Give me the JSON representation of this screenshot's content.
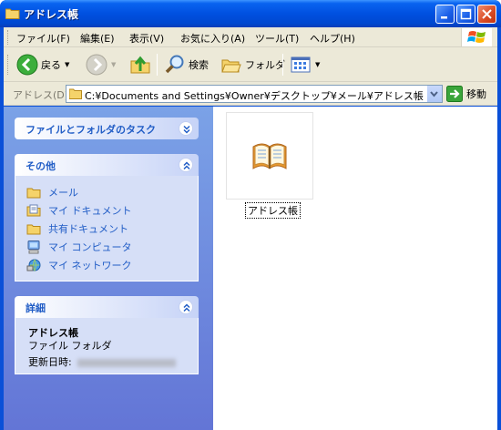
{
  "window": {
    "title": "アドレス帳"
  },
  "menu": {
    "items": [
      "ファイル(F)",
      "編集(E)",
      "表示(V)",
      "お気に入り(A)",
      "ツール(T)",
      "ヘルプ(H)"
    ]
  },
  "toolbar": {
    "back_label": "戻る",
    "search_label": "検索",
    "folders_label": "フォルダ"
  },
  "address": {
    "label": "アドレス(D)",
    "path": "C:¥Documents and Settings¥Owner¥デスクトップ¥メール¥アドレス帳",
    "go_label": "移動"
  },
  "taskpane": {
    "tasks_title": "ファイルとフォルダのタスク",
    "other_title": "その他",
    "other_links": [
      {
        "label": "メール",
        "icon": "folder-icon"
      },
      {
        "label": "マイ ドキュメント",
        "icon": "my-documents-icon"
      },
      {
        "label": "共有ドキュメント",
        "icon": "folder-icon"
      },
      {
        "label": "マイ コンピュータ",
        "icon": "my-computer-icon"
      },
      {
        "label": "マイ ネットワーク",
        "icon": "my-network-icon"
      }
    ],
    "details_title": "詳細",
    "details": {
      "name": "アドレス帳",
      "type": "ファイル フォルダ",
      "modified_label": "更新日時:"
    }
  },
  "files": [
    {
      "name": "アドレス帳",
      "icon": "address-book-icon"
    }
  ]
}
